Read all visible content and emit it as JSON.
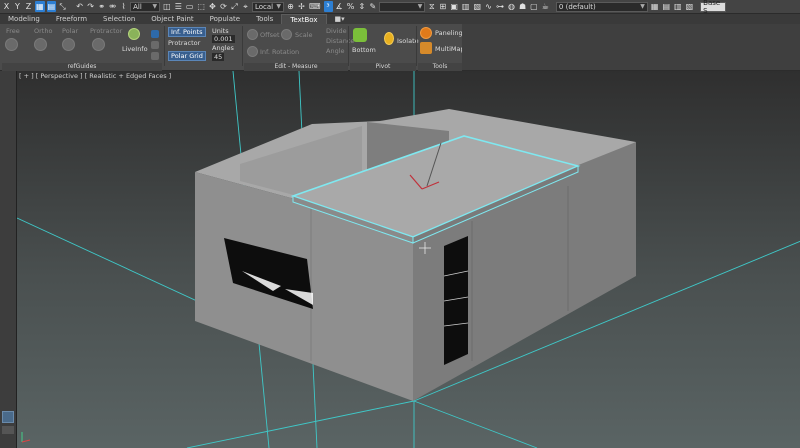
{
  "topbar": {
    "letters": [
      "X",
      "Y",
      "Z"
    ],
    "selection_filter": "All",
    "coord_system": "Local",
    "layer_value": "0 (default)",
    "workspace": "Base S"
  },
  "tabs": [
    {
      "label": "Modeling",
      "active": false
    },
    {
      "label": "Freeform",
      "active": false
    },
    {
      "label": "Selection",
      "active": false
    },
    {
      "label": "Object Paint",
      "active": false
    },
    {
      "label": "Populate",
      "active": false
    },
    {
      "label": "Tools",
      "active": false
    },
    {
      "label": "TextBox",
      "active": true
    }
  ],
  "ribbon": {
    "guides": {
      "free": "Free",
      "ortho": "Ortho",
      "polar": "Polar",
      "protractor": "Protractor",
      "liveinfo": "LiveInfo"
    },
    "snap": {
      "points": "Inf. Points",
      "protractor": "Protractor",
      "polar": "Polar Grid"
    },
    "units": {
      "label": "Units",
      "value": "0.001",
      "angles_label": "Angles",
      "angles_value": "45"
    },
    "edit": {
      "offset": "Offset",
      "scale": "Scale",
      "inf_rotation": "Inf. Rotation",
      "divide": "Divide",
      "distance": "Distance",
      "angle": "Angle"
    },
    "pivot": {
      "bottom": "Bottom",
      "isolate": "Isolate"
    },
    "tools": {
      "paneling": "Paneling",
      "multimap": "MultiMap"
    },
    "groups": {
      "refguides": "refGuides",
      "edit_measure": "Edit - Measure",
      "pivot": "Pivot",
      "tools": "Tools"
    }
  },
  "viewport": {
    "label": "[ + ] [ Perspective ] [ Realistic + Edged Faces ]"
  },
  "colors": {
    "selection": "#7fe8f0",
    "guide": "#3fc8c8",
    "wall": "#8f8f8f"
  }
}
